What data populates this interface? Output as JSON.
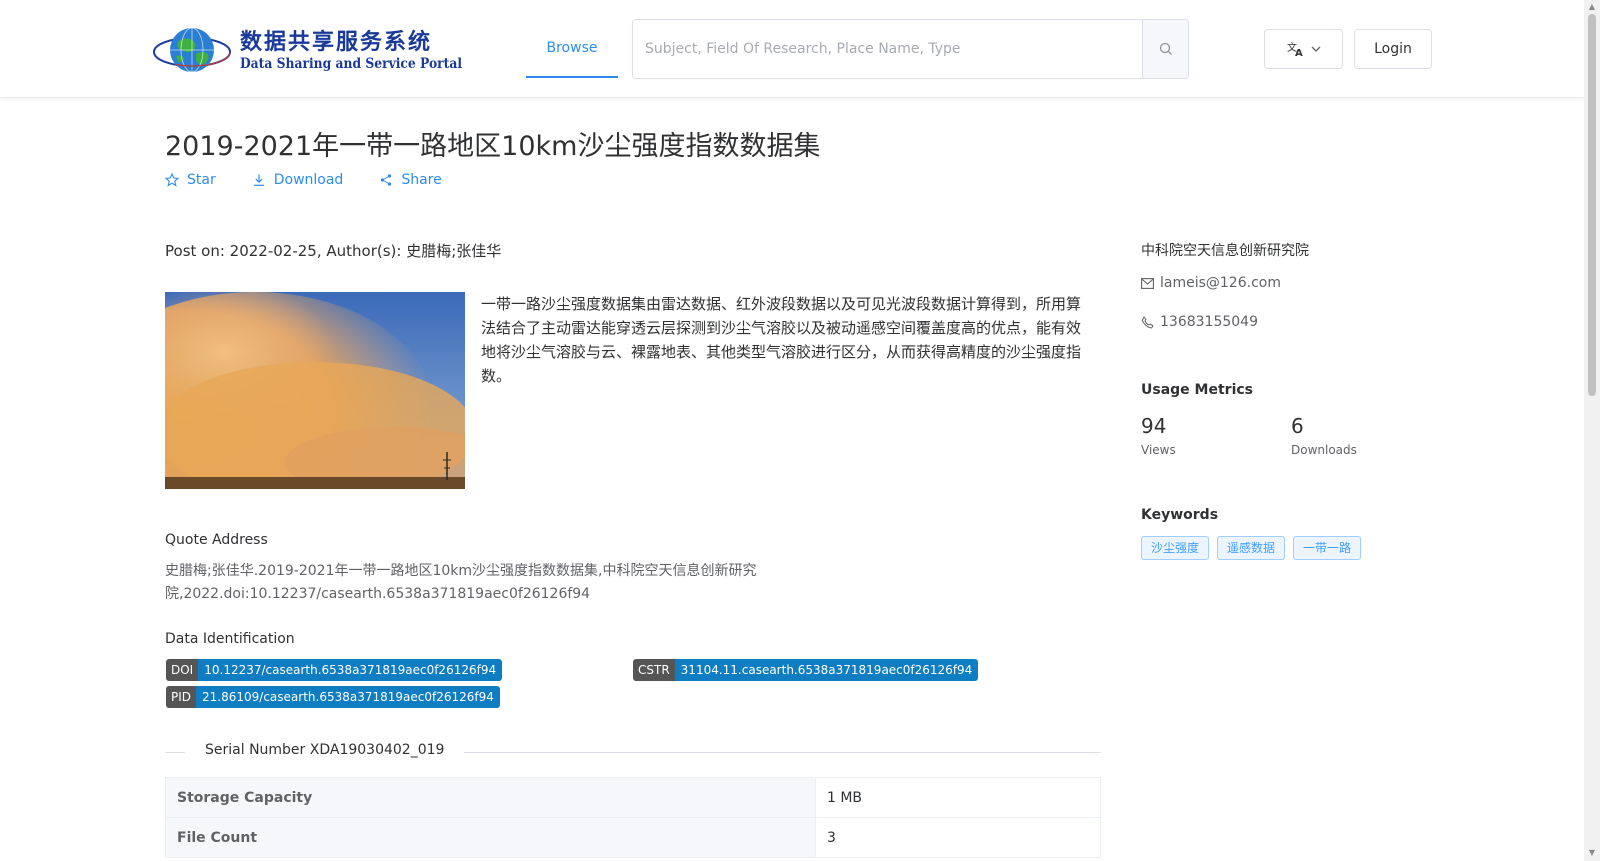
{
  "header": {
    "logo": {
      "cn_title": "数据共享服务系统",
      "en_title": "Data Sharing and Service Portal"
    },
    "nav": {
      "browse": "Browse"
    },
    "search": {
      "placeholder": "Subject, Field Of Research, Place Name, Type"
    },
    "login_label": "Login"
  },
  "dataset": {
    "title": "2019-2021年一带一路地区10km沙尘强度指数数据集",
    "actions": {
      "star": "Star",
      "download": "Download",
      "share": "Share"
    },
    "post_info": "Post on: 2022-02-25, Author(s): 史腊梅;张佳华",
    "description": "一带一路沙尘强度数据集由雷达数据、红外波段数据以及可见光波段数据计算得到，所用算法结合了主动雷达能穿透云层探测到沙尘气溶胶以及被动遥感空间覆盖度高的优点，能有效地将沙尘气溶胶与云、裸露地表、其他类型气溶胶进行区分，从而获得高精度的沙尘强度指数。",
    "quote": {
      "label": "Quote Address",
      "text": "史腊梅;张佳华.2019-2021年一带一路地区10km沙尘强度指数数据集,中科院空天信息创新研究院,2022.doi:10.12237/casearth.6538a371819aec0f26126f94"
    },
    "identification": {
      "label": "Data Identification",
      "doi": {
        "key": "DOI",
        "value": "10.12237/casearth.6538a371819aec0f26126f94"
      },
      "cstr": {
        "key": "CSTR",
        "value": "31104.11.casearth.6538a371819aec0f26126f94"
      },
      "pid": {
        "key": "PID",
        "value": "21.86109/casearth.6538a371819aec0f26126f94"
      }
    },
    "serial_number": "Serial Number XDA19030402_019",
    "info_rows": [
      {
        "key": "Storage Capacity",
        "value": "1 MB"
      },
      {
        "key": "File Count",
        "value": "3"
      }
    ]
  },
  "sidebar": {
    "organization": "中科院空天信息创新研究院",
    "email": "lameis@126.com",
    "phone": "13683155049",
    "usage": {
      "heading": "Usage Metrics",
      "views": {
        "value": "94",
        "label": "Views"
      },
      "downloads": {
        "value": "6",
        "label": "Downloads"
      }
    },
    "keywords": {
      "heading": "Keywords",
      "items": [
        "沙尘强度",
        "遥感数据",
        "一带一路"
      ]
    }
  },
  "colors": {
    "accent": "#2d8cf0",
    "id_value_bg": "#0f7dc2",
    "id_key_bg": "#555555",
    "keyword_border": "#a0cfff"
  }
}
